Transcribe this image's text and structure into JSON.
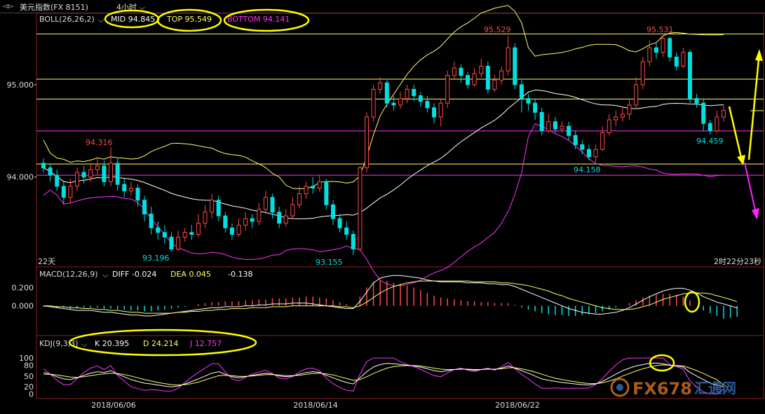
{
  "window": {
    "title": "美元指数(FX 8151)",
    "period": "4小时"
  },
  "main_panel": {
    "indicator_name": "BOLL(26,26,2)",
    "mid_label": "MID 94.845",
    "top_label": "TOP 95.549",
    "bottom_label": "BOTTOM 94.141",
    "price_ticks": [
      "95.000",
      "94.000"
    ],
    "annotations": [
      "95.529",
      "95.531",
      "94.316",
      "93.196",
      "93.155",
      "94.158",
      "94.459"
    ],
    "span_label": "22天",
    "countdown": "2时22分23秒"
  },
  "macd_panel": {
    "indicator_name": "MACD(12,26,9)",
    "diff_label": "DIFF -0.024",
    "dea_label": "DEA 0.045",
    "macd_value": "-0.138",
    "ticks": [
      "0.200",
      "0.000"
    ]
  },
  "kdj_panel": {
    "indicator_name": "KDJ(9,3,3)",
    "k_label": "K 20.395",
    "d_label": "D 24.214",
    "j_label": "J 12.757",
    "ticks": [
      "100",
      "80",
      "50",
      "20",
      "0"
    ]
  },
  "x_axis": {
    "dates": [
      "2018/06/06",
      "2018/06/14",
      "2018/06/22"
    ]
  },
  "watermark": {
    "text": "FX678",
    "subtext": "汇通网"
  },
  "colors": {
    "up": "#ff4a4a",
    "down": "#00e0e0",
    "boll_mid": "#ffffff",
    "boll_top": "#ffff66",
    "boll_bottom": "#ff33ff",
    "highlight": "#ffff00",
    "magenta_arrow": "#ff22ff"
  },
  "chart_data": {
    "type": "candlestick",
    "ylim": [
      93.05,
      95.75
    ],
    "horizontal_levels": {
      "yellow": [
        95.549,
        95.06,
        94.845,
        94.141
      ],
      "magenta": [
        94.5,
        94.02
      ]
    },
    "candles": [
      [
        94.15,
        94.1,
        94.2,
        94.05
      ],
      [
        94.1,
        94.02,
        94.15,
        93.95
      ],
      [
        94.02,
        93.9,
        94.08,
        93.85
      ],
      [
        93.9,
        93.78,
        93.96,
        93.7
      ],
      [
        93.78,
        93.9,
        93.98,
        93.72
      ],
      [
        93.9,
        94.05,
        94.1,
        93.85
      ],
      [
        94.05,
        94.0,
        94.12,
        93.93
      ],
      [
        94.0,
        94.08,
        94.15,
        93.95
      ],
      [
        94.08,
        94.12,
        94.2,
        94.02
      ],
      [
        94.12,
        93.95,
        94.18,
        93.9
      ],
      [
        93.95,
        94.15,
        94.32,
        93.9
      ],
      [
        94.15,
        93.92,
        94.2,
        93.85
      ],
      [
        93.92,
        93.85,
        93.98,
        93.78
      ],
      [
        93.85,
        93.88,
        93.95,
        93.8
      ],
      [
        93.88,
        93.75,
        93.92,
        93.68
      ],
      [
        93.75,
        93.6,
        93.8,
        93.52
      ],
      [
        93.6,
        93.45,
        93.68,
        93.38
      ],
      [
        93.45,
        93.4,
        93.52,
        93.32
      ],
      [
        93.4,
        93.35,
        93.48,
        93.28
      ],
      [
        93.35,
        93.22,
        93.4,
        93.196
      ],
      [
        93.22,
        93.35,
        93.42,
        93.2
      ],
      [
        93.35,
        93.4,
        93.45,
        93.3
      ],
      [
        93.4,
        93.38,
        93.48,
        93.32
      ],
      [
        93.38,
        93.5,
        93.6,
        93.35
      ],
      [
        93.5,
        93.62,
        93.7,
        93.45
      ],
      [
        93.62,
        93.75,
        93.82,
        93.55
      ],
      [
        93.75,
        93.58,
        93.8,
        93.52
      ],
      [
        93.58,
        93.45,
        93.62,
        93.4
      ],
      [
        93.45,
        93.38,
        93.5,
        93.32
      ],
      [
        93.38,
        93.48,
        93.55,
        93.35
      ],
      [
        93.48,
        93.55,
        93.62,
        93.42
      ],
      [
        93.55,
        93.52,
        93.6,
        93.45
      ],
      [
        93.52,
        93.65,
        93.72,
        93.48
      ],
      [
        93.65,
        93.78,
        93.85,
        93.6
      ],
      [
        93.78,
        93.62,
        93.82,
        93.55
      ],
      [
        93.62,
        93.5,
        93.68,
        93.45
      ],
      [
        93.5,
        93.58,
        93.65,
        93.46
      ],
      [
        93.58,
        93.7,
        93.78,
        93.55
      ],
      [
        93.7,
        93.82,
        93.9,
        93.66
      ],
      [
        93.82,
        93.9,
        93.95,
        93.76
      ],
      [
        93.9,
        93.88,
        94.0,
        93.82
      ],
      [
        93.88,
        93.95,
        94.02,
        93.84
      ],
      [
        93.95,
        93.7,
        93.98,
        93.65
      ],
      [
        93.7,
        93.55,
        93.75,
        93.48
      ],
      [
        93.55,
        93.45,
        93.6,
        93.4
      ],
      [
        93.45,
        93.38,
        93.52,
        93.32
      ],
      [
        93.38,
        93.22,
        93.42,
        93.155
      ],
      [
        93.22,
        94.1,
        94.12,
        93.2
      ],
      [
        94.1,
        94.65,
        94.7,
        94.05
      ],
      [
        94.65,
        94.95,
        95.0,
        94.6
      ],
      [
        94.95,
        95.02,
        95.08,
        94.9
      ],
      [
        95.02,
        94.8,
        95.05,
        94.75
      ],
      [
        94.8,
        94.78,
        94.88,
        94.72
      ],
      [
        94.78,
        94.85,
        94.92,
        94.74
      ],
      [
        94.85,
        94.95,
        95.0,
        94.8
      ],
      [
        94.95,
        94.88,
        95.0,
        94.82
      ],
      [
        94.88,
        94.82,
        94.92,
        94.76
      ],
      [
        94.82,
        94.75,
        94.88,
        94.7
      ],
      [
        94.75,
        94.65,
        94.8,
        94.58
      ],
      [
        94.65,
        94.8,
        94.85,
        94.55
      ],
      [
        94.8,
        95.1,
        95.15,
        94.75
      ],
      [
        95.1,
        95.18,
        95.25,
        95.05
      ],
      [
        95.18,
        95.1,
        95.22,
        95.02
      ],
      [
        95.1,
        95.0,
        95.14,
        94.96
      ],
      [
        95.0,
        95.12,
        95.18,
        94.98
      ],
      [
        95.12,
        95.2,
        95.28,
        95.08
      ],
      [
        95.2,
        94.95,
        95.25,
        94.9
      ],
      [
        94.95,
        95.05,
        95.1,
        94.92
      ],
      [
        95.05,
        95.15,
        95.2,
        95.0
      ],
      [
        95.15,
        95.4,
        95.529,
        95.1
      ],
      [
        95.4,
        95.0,
        95.45,
        94.95
      ],
      [
        95.0,
        94.85,
        95.05,
        94.7
      ],
      [
        94.85,
        94.8,
        94.9,
        94.72
      ],
      [
        94.8,
        94.7,
        94.85,
        94.62
      ],
      [
        94.7,
        94.5,
        94.75,
        94.45
      ],
      [
        94.5,
        94.6,
        94.68,
        94.48
      ],
      [
        94.6,
        94.52,
        94.65,
        94.48
      ],
      [
        94.52,
        94.55,
        94.6,
        94.48
      ],
      [
        94.55,
        94.45,
        94.6,
        94.4
      ],
      [
        94.45,
        94.35,
        94.5,
        94.3
      ],
      [
        94.35,
        94.3,
        94.4,
        94.25
      ],
      [
        94.3,
        94.22,
        94.35,
        94.18
      ],
      [
        94.22,
        94.3,
        94.35,
        94.158
      ],
      [
        94.3,
        94.48,
        94.55,
        94.28
      ],
      [
        94.48,
        94.62,
        94.68,
        94.45
      ],
      [
        94.62,
        94.65,
        94.72,
        94.55
      ],
      [
        94.65,
        94.68,
        94.75,
        94.6
      ],
      [
        94.68,
        94.78,
        94.85,
        94.62
      ],
      [
        94.78,
        95.0,
        95.08,
        94.75
      ],
      [
        95.0,
        95.25,
        95.3,
        94.95
      ],
      [
        95.25,
        95.4,
        95.48,
        95.2
      ],
      [
        95.4,
        95.35,
        95.45,
        95.28
      ],
      [
        95.35,
        95.5,
        95.531,
        95.3
      ],
      [
        95.5,
        95.3,
        95.52,
        95.25
      ],
      [
        95.3,
        95.2,
        95.35,
        95.15
      ],
      [
        95.2,
        95.35,
        95.4,
        95.18
      ],
      [
        95.35,
        94.85,
        95.38,
        94.8
      ],
      [
        94.85,
        94.8,
        94.9,
        94.75
      ],
      [
        94.8,
        94.58,
        94.85,
        94.5
      ],
      [
        94.58,
        94.5,
        94.62,
        94.459
      ],
      [
        94.5,
        94.65,
        94.72,
        94.48
      ],
      [
        94.65,
        94.72,
        94.78,
        94.6
      ]
    ],
    "macd_histogram": [
      -0.01,
      -0.01,
      -0.02,
      -0.02,
      -0.03,
      -0.03,
      -0.02,
      -0.02,
      -0.02,
      -0.03,
      -0.03,
      -0.04,
      -0.04,
      -0.05,
      -0.05,
      -0.06,
      -0.06,
      -0.05,
      -0.04,
      -0.03,
      -0.02,
      -0.01,
      0.0,
      0.02,
      0.03,
      0.04,
      0.04,
      0.05,
      0.05,
      0.05,
      0.06,
      0.06,
      0.07,
      0.07,
      0.08,
      0.08,
      0.08,
      0.09,
      0.09,
      0.1,
      0.1,
      0.09,
      0.08,
      0.06,
      0.04,
      0.02,
      0.0,
      0.1,
      0.2,
      0.26,
      0.28,
      0.27,
      0.25,
      0.24,
      0.22,
      0.2,
      0.17,
      0.14,
      0.11,
      0.09,
      0.08,
      0.07,
      0.06,
      0.05,
      0.05,
      0.04,
      0.04,
      0.03,
      0.03,
      0.03,
      0.01,
      -0.02,
      -0.04,
      -0.06,
      -0.08,
      -0.09,
      -0.1,
      -0.1,
      -0.11,
      -0.11,
      -0.1,
      -0.09,
      -0.08,
      -0.06,
      -0.04,
      -0.02,
      0.0,
      0.03,
      0.06,
      0.09,
      0.11,
      0.12,
      0.13,
      0.13,
      0.12,
      0.1,
      0.06,
      0.0,
      -0.05,
      -0.08,
      -0.11,
      -0.14,
      -0.13,
      -0.12
    ],
    "macd_diff": [
      0.0,
      -0.01,
      -0.02,
      -0.03,
      -0.04,
      -0.05,
      -0.05,
      -0.05,
      -0.06,
      -0.07,
      -0.07,
      -0.08,
      -0.09,
      -0.1,
      -0.1,
      -0.11,
      -0.11,
      -0.1,
      -0.09,
      -0.08,
      -0.07,
      -0.06,
      -0.05,
      -0.04,
      -0.03,
      -0.02,
      -0.02,
      -0.01,
      -0.01,
      -0.01,
      0.0,
      0.0,
      0.01,
      0.01,
      0.02,
      0.02,
      0.02,
      0.03,
      0.03,
      0.03,
      0.02,
      0.01,
      0.0,
      -0.01,
      -0.02,
      -0.03,
      -0.03,
      0.05,
      0.15,
      0.25,
      0.3,
      0.32,
      0.33,
      0.33,
      0.32,
      0.31,
      0.3,
      0.28,
      0.27,
      0.26,
      0.26,
      0.26,
      0.26,
      0.25,
      0.25,
      0.25,
      0.24,
      0.24,
      0.23,
      0.23,
      0.21,
      0.18,
      0.15,
      0.12,
      0.09,
      0.06,
      0.03,
      0.0,
      -0.03,
      -0.05,
      -0.07,
      -0.08,
      -0.09,
      -0.09,
      -0.08,
      -0.07,
      -0.05,
      -0.02,
      0.02,
      0.06,
      0.1,
      0.13,
      0.16,
      0.18,
      0.19,
      0.19,
      0.17,
      0.14,
      0.1,
      0.07,
      0.04,
      0.02,
      0.0,
      -0.024
    ],
    "macd_dea": [
      0.0,
      0.0,
      -0.01,
      -0.01,
      -0.02,
      -0.02,
      -0.03,
      -0.03,
      -0.04,
      -0.04,
      -0.05,
      -0.05,
      -0.06,
      -0.07,
      -0.07,
      -0.08,
      -0.08,
      -0.08,
      -0.08,
      -0.08,
      -0.07,
      -0.07,
      -0.06,
      -0.06,
      -0.05,
      -0.05,
      -0.04,
      -0.04,
      -0.03,
      -0.03,
      -0.03,
      -0.02,
      -0.02,
      -0.02,
      -0.01,
      -0.01,
      -0.01,
      0.0,
      0.0,
      0.0,
      0.0,
      0.0,
      0.0,
      0.0,
      -0.01,
      -0.01,
      -0.02,
      0.0,
      0.04,
      0.09,
      0.14,
      0.18,
      0.21,
      0.23,
      0.25,
      0.26,
      0.27,
      0.27,
      0.27,
      0.27,
      0.27,
      0.27,
      0.27,
      0.27,
      0.26,
      0.26,
      0.26,
      0.26,
      0.25,
      0.25,
      0.24,
      0.23,
      0.22,
      0.2,
      0.18,
      0.16,
      0.13,
      0.11,
      0.08,
      0.06,
      0.04,
      0.02,
      0.0,
      -0.02,
      -0.03,
      -0.04,
      -0.04,
      -0.04,
      -0.03,
      -0.01,
      0.01,
      0.04,
      0.07,
      0.09,
      0.11,
      0.13,
      0.14,
      0.14,
      0.14,
      0.13,
      0.11,
      0.09,
      0.07,
      0.045
    ],
    "kdj_k": [
      60,
      55,
      48,
      42,
      40,
      45,
      52,
      58,
      62,
      60,
      65,
      55,
      48,
      40,
      35,
      30,
      28,
      25,
      22,
      20,
      22,
      28,
      35,
      42,
      50,
      58,
      62,
      55,
      48,
      45,
      48,
      52,
      55,
      58,
      55,
      50,
      48,
      50,
      55,
      60,
      62,
      60,
      52,
      45,
      38,
      32,
      28,
      45,
      62,
      75,
      82,
      85,
      84,
      82,
      80,
      78,
      75,
      70,
      65,
      62,
      65,
      68,
      70,
      68,
      66,
      68,
      70,
      68,
      72,
      78,
      72,
      65,
      58,
      50,
      42,
      38,
      35,
      32,
      30,
      28,
      26,
      25,
      28,
      35,
      45,
      55,
      65,
      72,
      78,
      82,
      85,
      86,
      84,
      80,
      78,
      75,
      60,
      50,
      40,
      30,
      25,
      20.395
    ],
    "kdj_d": [
      55,
      55,
      53,
      50,
      47,
      46,
      48,
      51,
      54,
      56,
      58,
      57,
      54,
      50,
      45,
      40,
      36,
      32,
      29,
      26,
      25,
      26,
      29,
      33,
      39,
      45,
      51,
      52,
      51,
      49,
      49,
      50,
      52,
      54,
      54,
      53,
      51,
      51,
      52,
      55,
      57,
      58,
      56,
      53,
      48,
      43,
      38,
      40,
      48,
      57,
      65,
      72,
      76,
      78,
      79,
      79,
      78,
      75,
      72,
      69,
      68,
      68,
      69,
      69,
      68,
      68,
      69,
      69,
      70,
      73,
      73,
      70,
      66,
      61,
      55,
      49,
      44,
      40,
      37,
      34,
      31,
      29,
      29,
      31,
      36,
      42,
      50,
      57,
      64,
      70,
      75,
      79,
      81,
      80,
      79,
      78,
      72,
      65,
      57,
      48,
      40,
      24.214
    ],
    "kdj_j": [
      70,
      55,
      38,
      26,
      26,
      43,
      60,
      72,
      78,
      68,
      79,
      51,
      36,
      20,
      15,
      10,
      12,
      11,
      8,
      8,
      16,
      32,
      47,
      60,
      72,
      84,
      84,
      61,
      42,
      37,
      46,
      56,
      61,
      66,
      57,
      44,
      42,
      48,
      61,
      70,
      72,
      64,
      44,
      29,
      18,
      10,
      8,
      55,
      90,
      100,
      100,
      100,
      100,
      90,
      82,
      76,
      69,
      60,
      51,
      48,
      59,
      68,
      72,
      66,
      62,
      68,
      72,
      66,
      76,
      88,
      70,
      55,
      42,
      28,
      16,
      16,
      17,
      16,
      16,
      16,
      16,
      17,
      26,
      43,
      63,
      81,
      95,
      100,
      100,
      100,
      100,
      100,
      100,
      82,
      76,
      69,
      36,
      20,
      6,
      0,
      0,
      12.757
    ]
  }
}
